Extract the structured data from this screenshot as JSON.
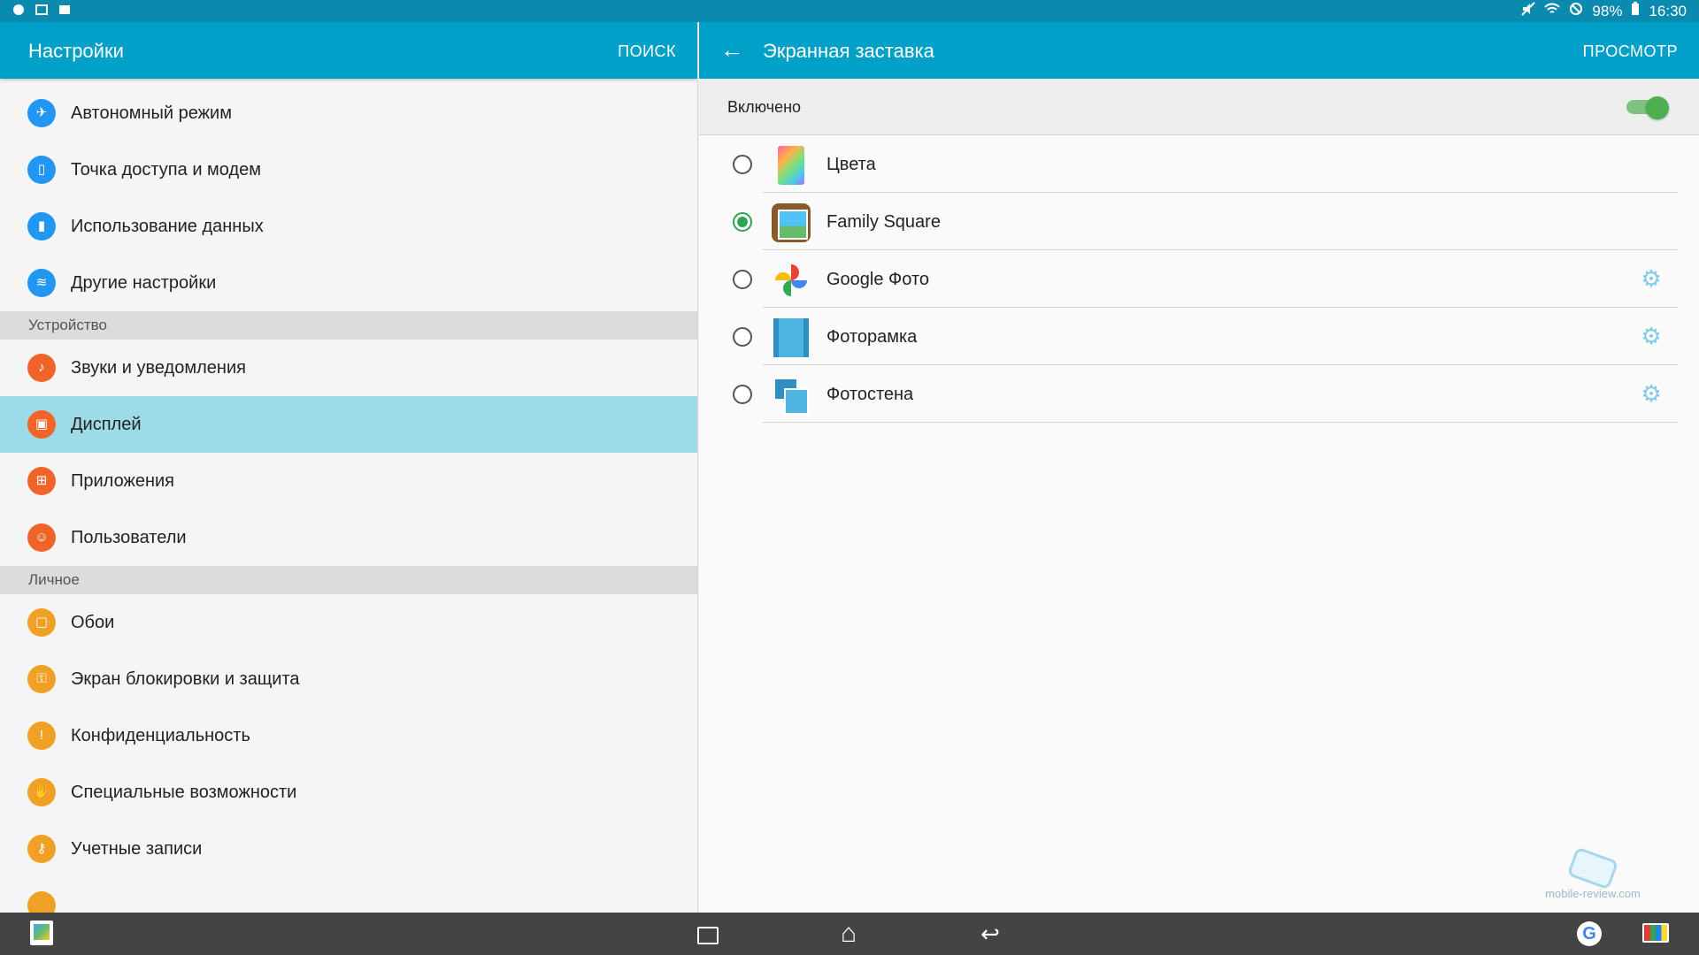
{
  "status_bar": {
    "left_icons": [
      "notification-icon",
      "gallery-icon",
      "photo-icon"
    ],
    "right_icons": [
      "mute-icon",
      "wifi-icon",
      "blocked-icon",
      "battery-icon"
    ],
    "battery": "98%",
    "time": "16:30"
  },
  "left": {
    "title": "Настройки",
    "action": "ПОИСК",
    "items_top": [
      {
        "label": "Автономный режим",
        "icon": "airplane-icon",
        "glyph": "✈"
      },
      {
        "label": "Точка доступа и модем",
        "icon": "hotspot-icon",
        "glyph": "▯"
      },
      {
        "label": "Использование данных",
        "icon": "data-usage-icon",
        "glyph": "▮"
      },
      {
        "label": "Другие настройки",
        "icon": "more-networks-icon",
        "glyph": "≋"
      }
    ],
    "section_device": "Устройство",
    "items_device": [
      {
        "label": "Звуки и уведомления",
        "icon": "sound-icon",
        "glyph": "♪"
      },
      {
        "label": "Дисплей",
        "icon": "display-icon",
        "glyph": "▣",
        "selected": true
      },
      {
        "label": "Приложения",
        "icon": "apps-icon",
        "glyph": "⊞"
      },
      {
        "label": "Пользователи",
        "icon": "users-icon",
        "glyph": "☺"
      }
    ],
    "section_personal": "Личное",
    "items_personal": [
      {
        "label": "Обои",
        "icon": "wallpaper-icon",
        "glyph": "▢"
      },
      {
        "label": "Экран блокировки и защита",
        "icon": "lock-icon",
        "glyph": "⚿"
      },
      {
        "label": "Конфиденциальность",
        "icon": "privacy-icon",
        "glyph": "!"
      },
      {
        "label": "Специальные возможности",
        "icon": "accessibility-icon",
        "glyph": "✋"
      },
      {
        "label": "Учетные записи",
        "icon": "key-icon",
        "glyph": "⚷"
      }
    ]
  },
  "right": {
    "title": "Экранная заставка",
    "action": "ПРОСМОТР",
    "enabled_label": "Включено",
    "enabled": true,
    "options": [
      {
        "label": "Цвета",
        "icon": "colors-icon",
        "selected": false,
        "has_settings": false
      },
      {
        "label": "Family Square",
        "icon": "family-square-icon",
        "selected": true,
        "has_settings": false
      },
      {
        "label": "Google Фото",
        "icon": "google-photos-icon",
        "selected": false,
        "has_settings": true
      },
      {
        "label": "Фоторамка",
        "icon": "photo-frame-icon",
        "selected": false,
        "has_settings": true
      },
      {
        "label": "Фотостена",
        "icon": "photo-wall-icon",
        "selected": false,
        "has_settings": true
      }
    ]
  },
  "watermark": "mobile-review.com",
  "nav": {
    "icons": [
      "app-shortcut-icon",
      "recent-apps-icon",
      "home-icon",
      "back-icon",
      "google-icon",
      "screen-mirror-icon"
    ]
  },
  "colors": {
    "app_bar": "#00a0c8",
    "status_bar": "#0b8ab0",
    "selected_row": "#9cdbe7",
    "toggle_on": "#4caf50",
    "radio_checked": "#2ea44f"
  }
}
